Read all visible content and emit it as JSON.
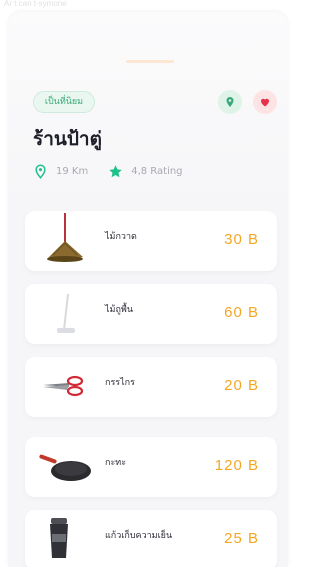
{
  "status_bar": {
    "text": "Ar t can t-symone"
  },
  "store": {
    "badge": "เป็นที่นิยม",
    "name": "ร้านป้าตู่",
    "distance": "19 Km",
    "rating": "4,8 Rating"
  },
  "colors": {
    "accent_green": "#3aa978",
    "favorite_red": "#e8304a",
    "price_orange": "#f5a623"
  },
  "icons": {
    "location": "location-icon",
    "favorite": "heart-icon",
    "distance": "map-pin-icon",
    "rating": "star-icon"
  },
  "products": [
    {
      "name": "ไม้กวาด",
      "price": "30 B",
      "icon": "broom-icon"
    },
    {
      "name": "ไม้ถูพื้น",
      "price": "60 B",
      "icon": "mop-icon"
    },
    {
      "name": "กรรไกร",
      "price": "20 B",
      "icon": "scissors-icon"
    },
    {
      "name": "กะทะ",
      "price": "120 B",
      "icon": "frying-pan-icon"
    },
    {
      "name": "แก้วเก็บความเย็น",
      "price": "25 B",
      "icon": "tumbler-icon"
    }
  ]
}
